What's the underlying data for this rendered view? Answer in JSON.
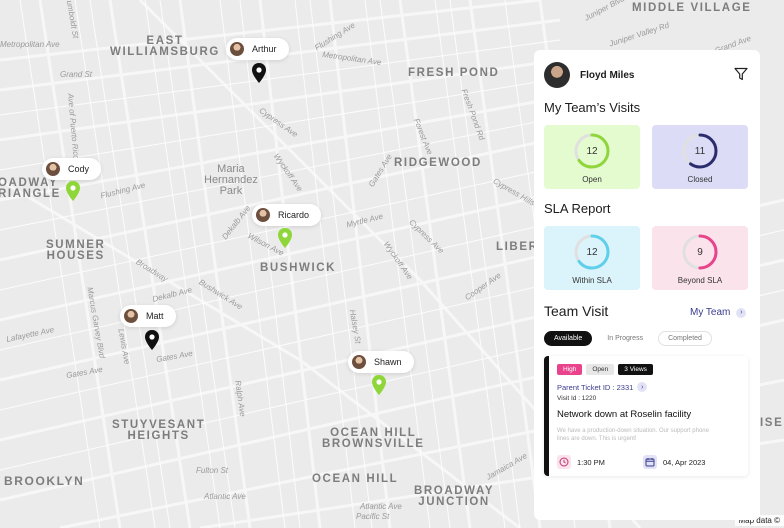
{
  "map": {
    "street_labels": [
      "Humboldt St",
      "Metropolitan Ave",
      "Grand St",
      "Flushing Ave",
      "Metropolitan Ave",
      "Cypress Ave",
      "Wyckoff Ave",
      "Fresh Pond Rd",
      "Forest Ave",
      "Gates Ave",
      "Cypress Hills St",
      "Flushing Ave",
      "Myrtle Ave",
      "Cypress Ave",
      "Wilson Ave",
      "Dekalb Ave",
      "Broadway",
      "Dekalb Ave",
      "Bushwick Ave",
      "Marcus Garvey Blvd",
      "Lewis Ave",
      "Gates Ave",
      "Lafayette Ave",
      "Gates Ave",
      "Halsey St",
      "Wyckoff Ave",
      "Cooper Ave",
      "Ave of Puerto Rico",
      "Ralph Ave",
      "Fulton St",
      "Atlantic Ave",
      "Jamaica Ave",
      "Atlantic Ave",
      "Pacific St",
      "Juniper Blvd N",
      "Juniper Valley Rd",
      "Grand Ave"
    ],
    "area_labels": {
      "east_williamsburg": "EAST\nWILLIAMSBURG",
      "fresh_pond": "FRESH POND",
      "middle_village": "MIDDLE VILLAGE",
      "ridgewood": "RIDGEWOOD",
      "maria_park": "Maria\nHernandez\nPark",
      "broadway_triangle": "OADWAY\nRIANGLE",
      "sumner_houses": "SUMNER\nHOUSES",
      "bushwick": "BUSHWICK",
      "liberty": "LIBER",
      "stuyvesant_heights": "STUYVESANT\nHEIGHTS",
      "ocean_hill_brownsville": "OCEAN HILL\nBROWNSVILLE",
      "ocean_hill": "OCEAN HILL",
      "brooklyn": "BROOKLYN",
      "broadway_junction": "BROADWAY\nJUNCTION",
      "isem": "ISEM"
    },
    "credit": "Map data ©",
    "people": [
      {
        "name": "Arthur",
        "pin_color": "#111111"
      },
      {
        "name": "Cody",
        "pin_color": "#8fd63a"
      },
      {
        "name": "Ricardo",
        "pin_color": "#8fd63a"
      },
      {
        "name": "Matt",
        "pin_color": "#111111"
      },
      {
        "name": "Shawn",
        "pin_color": "#8fd63a"
      }
    ]
  },
  "panel": {
    "user_name": "Floyd Miles",
    "my_team_visits_title": "My Team’s Visits",
    "visits": [
      {
        "label": "Open",
        "value": "12",
        "fraction": 0.65,
        "bg": "#e4fbd0",
        "color": "#8fd63a"
      },
      {
        "label": "Closed",
        "value": "11",
        "fraction": 0.6,
        "bg": "#dcdcf7",
        "color": "#2a2c6e"
      }
    ],
    "sla_title": "SLA Report",
    "sla": [
      {
        "label": "Within SLA",
        "value": "12",
        "fraction": 0.65,
        "bg": "#dbf4fb",
        "color": "#5fd0ec"
      },
      {
        "label": "Beyond SLA",
        "value": "9",
        "fraction": 0.5,
        "bg": "#fbe3ec",
        "color": "#e8438b"
      }
    ],
    "team_visit_title": "Team Visit",
    "my_team_link": "My Team",
    "tabs": [
      "Available",
      "In Progress",
      "Completed"
    ],
    "ticket": {
      "priority": "High",
      "status": "Open",
      "views": "3 Views",
      "parent_ticket": "Parent Ticket ID : 2331",
      "visit_id": "Visit Id : 1220",
      "title": "Network down at Roselin facility",
      "description": "We have a production-down situation. Our support phone lines are down. This is urgent!",
      "time": "1:30 PM",
      "date": "04, Apr 2023"
    }
  },
  "colors": {
    "accent": "#3a3c8c",
    "green": "#8fd63a",
    "pink": "#e8438b"
  }
}
